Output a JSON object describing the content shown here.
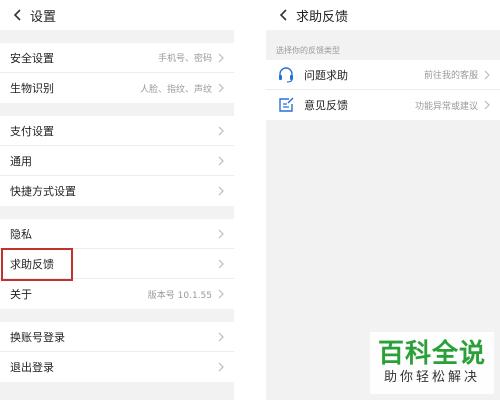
{
  "settings": {
    "title": "设置",
    "groups": [
      {
        "items": [
          {
            "label": "安全设置",
            "value": "手机号、密码"
          },
          {
            "label": "生物识别",
            "value": "人脸、指纹、声纹"
          }
        ]
      },
      {
        "items": [
          {
            "label": "支付设置",
            "value": ""
          },
          {
            "label": "通用",
            "value": ""
          },
          {
            "label": "快捷方式设置",
            "value": ""
          }
        ]
      },
      {
        "items": [
          {
            "label": "隐私",
            "value": ""
          },
          {
            "label": "求助反馈",
            "value": ""
          },
          {
            "label": "关于",
            "value": "版本号 10.1.55"
          }
        ]
      },
      {
        "items": [
          {
            "label": "换账号登录",
            "value": ""
          },
          {
            "label": "退出登录",
            "value": ""
          }
        ]
      }
    ]
  },
  "feedback": {
    "title": "求助反馈",
    "caption": "选择你的反馈类型",
    "items": [
      {
        "label": "问题求助",
        "value": "前往我的客服",
        "icon": "headset-icon"
      },
      {
        "label": "意见反馈",
        "value": "功能异常或建议",
        "icon": "edit-form-icon"
      }
    ]
  },
  "watermark": {
    "main": "百科全说",
    "sub": "助你轻松解决"
  },
  "colors": {
    "highlight": "#c0312f",
    "icon_blue": "#2a6fd6",
    "watermark_green": "#2aa138"
  }
}
